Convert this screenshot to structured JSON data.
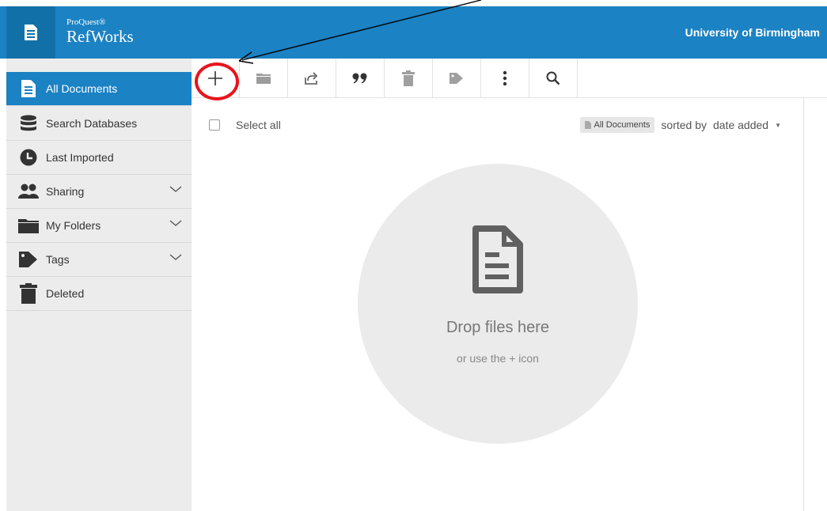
{
  "header": {
    "brand_small": "ProQuest®",
    "brand_big": "RefWorks",
    "institution": "University of Birmingham",
    "color": "#1b82c3"
  },
  "sidebar": {
    "items": [
      {
        "label": "All Documents",
        "icon": "document-icon",
        "active": true
      },
      {
        "label": "Search Databases",
        "icon": "database-icon"
      },
      {
        "label": "Last Imported",
        "icon": "clock-icon"
      },
      {
        "label": "Sharing",
        "icon": "people-icon",
        "expandable": true
      },
      {
        "label": "My Folders",
        "icon": "folder-icon",
        "expandable": true
      },
      {
        "label": "Tags",
        "icon": "tag-icon",
        "expandable": true
      },
      {
        "label": "Deleted",
        "icon": "trash-icon"
      }
    ]
  },
  "toolbar": {
    "buttons": [
      "add-icon",
      "folder-icon",
      "share-icon",
      "quote-icon",
      "trash-icon",
      "tag-icon",
      "more-icon",
      "search-icon"
    ]
  },
  "list": {
    "select_all": "Select all",
    "view_chip": "All Documents",
    "sorted_by": "sorted by",
    "sort_value": "date added"
  },
  "dropzone": {
    "title": "Drop files here",
    "subtitle": "or use the + icon"
  },
  "annotation": {
    "ring_color": "#e8141c"
  }
}
